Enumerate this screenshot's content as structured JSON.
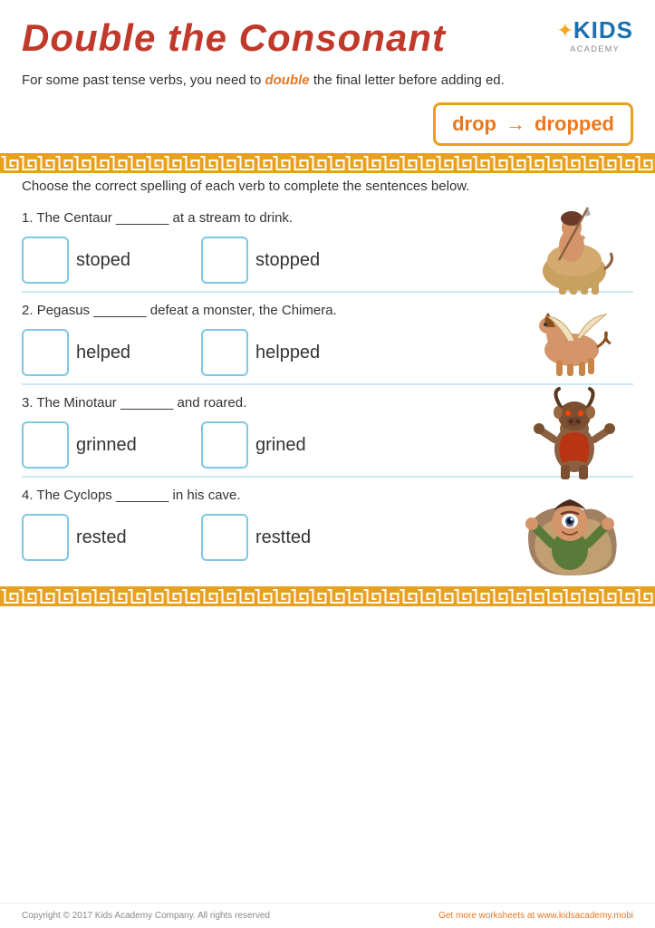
{
  "header": {
    "title": "Double the Consonant",
    "logo": {
      "star": "✦",
      "kids": "KIDS",
      "academy": "ACADEMY"
    }
  },
  "instruction": {
    "text_before": "For some past tense verbs, you need to ",
    "bold": "double",
    "text_after": " the final letter before adding ed."
  },
  "example": {
    "word": "drop",
    "arrow": "→",
    "result": "dropped"
  },
  "choose_instruction": "Choose the correct spelling of each verb to complete the sentences below.",
  "questions": [
    {
      "number": "1.",
      "text": "The Centaur _______ at a stream to drink.",
      "choice1": "stoped",
      "choice2": "stopped",
      "creature": "centaur"
    },
    {
      "number": "2.",
      "text": "Pegasus _______ defeat a monster, the Chimera.",
      "choice1": "helped",
      "choice2": "helpped",
      "creature": "pegasus"
    },
    {
      "number": "3.",
      "text": "The Minotaur _______ and roared.",
      "choice1": "grinned",
      "choice2": "grined",
      "creature": "minotaur"
    },
    {
      "number": "4.",
      "text": "The Cyclops _______ in his cave.",
      "choice1": "rested",
      "choice2": "restted",
      "creature": "cyclops"
    }
  ],
  "footer": {
    "left": "Copyright © 2017 Kids Academy Company. All rights reserved",
    "right": "Get more worksheets at www.kidsacademy.mobi"
  }
}
